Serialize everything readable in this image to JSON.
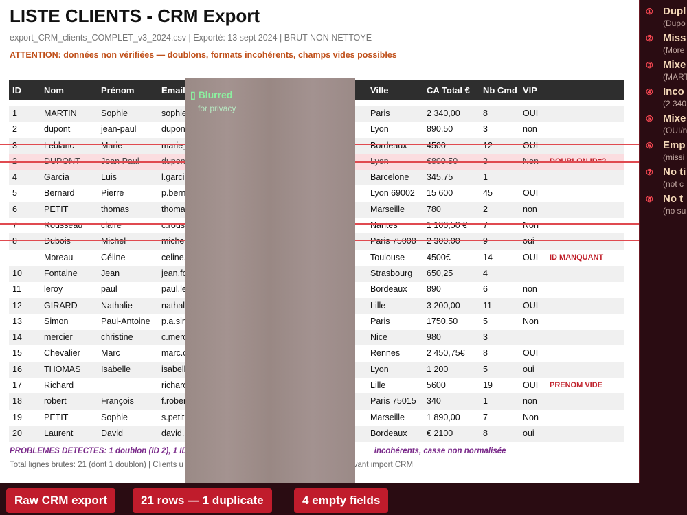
{
  "doc": {
    "title": "LISTE CLIENTS - CRM Export",
    "meta": "export_CRM_clients_COMPLET_v3_2024.csv  |  Exporté: 13 sept 2024  |  BRUT NON NETTOYE",
    "warning": "ATTENTION: données non vérifiées — doublons, formats incohérents, champs vides possibles"
  },
  "table": {
    "headers": [
      "ID",
      "Nom",
      "Prénom",
      "Email",
      "Ville",
      "CA Total €",
      "Nb Cmd",
      "VIP"
    ],
    "rows": [
      {
        "id": "1",
        "nom": "MARTIN",
        "prenom": "Sophie",
        "email": "sophie",
        "ville": "Paris",
        "ca": "2 340,00",
        "nb": "8",
        "vip": "OUI",
        "note": ""
      },
      {
        "id": "2",
        "nom": "dupont",
        "prenom": "jean-paul",
        "email": "dupon",
        "ville": "Lyon",
        "ca": "890.50",
        "nb": "3",
        "vip": "non",
        "note": ""
      },
      {
        "id": "3",
        "nom": "Leblanc",
        "prenom": "Marie",
        "email": "marie_",
        "ville": "Bordeaux",
        "ca": "4500",
        "nb": "12",
        "vip": "OUI",
        "note": ""
      },
      {
        "id": "2",
        "nom": "DUPONT",
        "prenom": "Jean Paul",
        "email": "dupon",
        "ville": "Lyon",
        "ca": "€890,50",
        "nb": "3",
        "vip": "Non",
        "note": "DOUBLON ID=2"
      },
      {
        "id": "4",
        "nom": "Garcia",
        "prenom": "Luis",
        "email": "l.garci",
        "ville": "Barcelone",
        "ca": "345.75",
        "nb": "1",
        "vip": "",
        "note": ""
      },
      {
        "id": "5",
        "nom": "Bernard",
        "prenom": "Pierre",
        "email": "p.bern",
        "ville": "Lyon 69002",
        "ca": "15 600",
        "nb": "45",
        "vip": "OUI",
        "note": ""
      },
      {
        "id": "6",
        "nom": "PETIT",
        "prenom": "thomas",
        "email": "thoma",
        "ville": "Marseille",
        "ca": "780",
        "nb": "2",
        "vip": "non",
        "note": ""
      },
      {
        "id": "7",
        "nom": "Rousseau",
        "prenom": "claire",
        "email": "c.rous",
        "ville": "Nantes",
        "ca": "1 100,50 €",
        "nb": "7",
        "vip": "Non",
        "note": ""
      },
      {
        "id": "8",
        "nom": "Dubois",
        "prenom": "Michel",
        "email": "miche",
        "ville": "Paris 75008",
        "ca": "2 300.00",
        "nb": "9",
        "vip": "oui",
        "note": ""
      },
      {
        "id": "",
        "nom": "Moreau",
        "prenom": "Céline",
        "email": "celine.",
        "ville": "Toulouse",
        "ca": "4500€",
        "nb": "14",
        "vip": "OUI",
        "note": "ID MANQUANT"
      },
      {
        "id": "10",
        "nom": "Fontaine",
        "prenom": "Jean",
        "email": "jean.fc",
        "ville": "Strasbourg",
        "ca": "650,25",
        "nb": "4",
        "vip": "",
        "note": ""
      },
      {
        "id": "11",
        "nom": "leroy",
        "prenom": "paul",
        "email": "paul.le",
        "ville": "Bordeaux",
        "ca": "890",
        "nb": "6",
        "vip": "non",
        "note": ""
      },
      {
        "id": "12",
        "nom": "GIRARD",
        "prenom": "Nathalie",
        "email": "nathal",
        "ville": "Lille",
        "ca": "3 200,00",
        "nb": "11",
        "vip": "OUI",
        "note": ""
      },
      {
        "id": "13",
        "nom": "Simon",
        "prenom": "Paul-Antoine",
        "email": "p.a.sir",
        "ville": "Paris",
        "ca": "1750.50",
        "nb": "5",
        "vip": "Non",
        "note": ""
      },
      {
        "id": "14",
        "nom": "mercier",
        "prenom": "christine",
        "email": "c.merc",
        "ville": "Nice",
        "ca": "980",
        "nb": "3",
        "vip": "",
        "note": ""
      },
      {
        "id": "15",
        "nom": "Chevalier",
        "prenom": "Marc",
        "email": "marc.c",
        "ville": "Rennes",
        "ca": "2 450,75€",
        "nb": "8",
        "vip": "OUI",
        "note": ""
      },
      {
        "id": "16",
        "nom": "THOMAS",
        "prenom": "Isabelle",
        "email": "isabell",
        "ville": "Lyon",
        "ca": "1 200",
        "nb": "5",
        "vip": "oui",
        "note": ""
      },
      {
        "id": "17",
        "nom": "Richard",
        "prenom": "",
        "email": "richarc",
        "ville": "Lille",
        "ca": "5600",
        "nb": "19",
        "vip": "OUI",
        "note": "PRENOM VIDE"
      },
      {
        "id": "18",
        "nom": "robert",
        "prenom": "François",
        "email": "f.rober",
        "ville": "Paris 75015",
        "ca": "340",
        "nb": "1",
        "vip": "non",
        "note": ""
      },
      {
        "id": "19",
        "nom": "PETIT",
        "prenom": "Sophie",
        "email": "s.petit",
        "ville": "Marseille",
        "ca": "1 890,00",
        "nb": "7",
        "vip": "Non",
        "note": ""
      },
      {
        "id": "20",
        "nom": "Laurent",
        "prenom": "David",
        "email": "david.",
        "ville": "Bordeaux",
        "ca": "€ 2100",
        "nb": "8",
        "vip": "oui",
        "note": ""
      }
    ]
  },
  "footer": {
    "problems_left": "PROBLEMES DETECTES: 1 doublon (ID 2), 1 ID",
    "problems_right": "incohérents, casse non normalisée",
    "total_left": "Total lignes brutes: 21 (dont 1 doublon) | Clients u",
    "total_right": "er avant import CRM"
  },
  "blur": {
    "title": "Blurred",
    "subtitle": "for privacy"
  },
  "sidebar": [
    {
      "num": "①",
      "title": "Dupl",
      "sub": "(Dupo"
    },
    {
      "num": "②",
      "title": "Miss",
      "sub": "(More"
    },
    {
      "num": "③",
      "title": "Mixe",
      "sub": "(MART"
    },
    {
      "num": "④",
      "title": "Inco",
      "sub": "(2 340"
    },
    {
      "num": "⑤",
      "title": "Mixe",
      "sub": "(OUI/n"
    },
    {
      "num": "⑥",
      "title": "Emp",
      "sub": "(missi"
    },
    {
      "num": "⑦",
      "title": "No ti",
      "sub": "(not c"
    },
    {
      "num": "⑧",
      "title": "No t",
      "sub": "(no su"
    }
  ],
  "badges": [
    "Raw CRM export",
    "21 rows — 1 duplicate",
    "4 empty fields"
  ],
  "colors": {
    "accent": "#c01c2c",
    "panel": "#2a0c12",
    "note": "#c0202a",
    "warning": "#c0501a"
  }
}
